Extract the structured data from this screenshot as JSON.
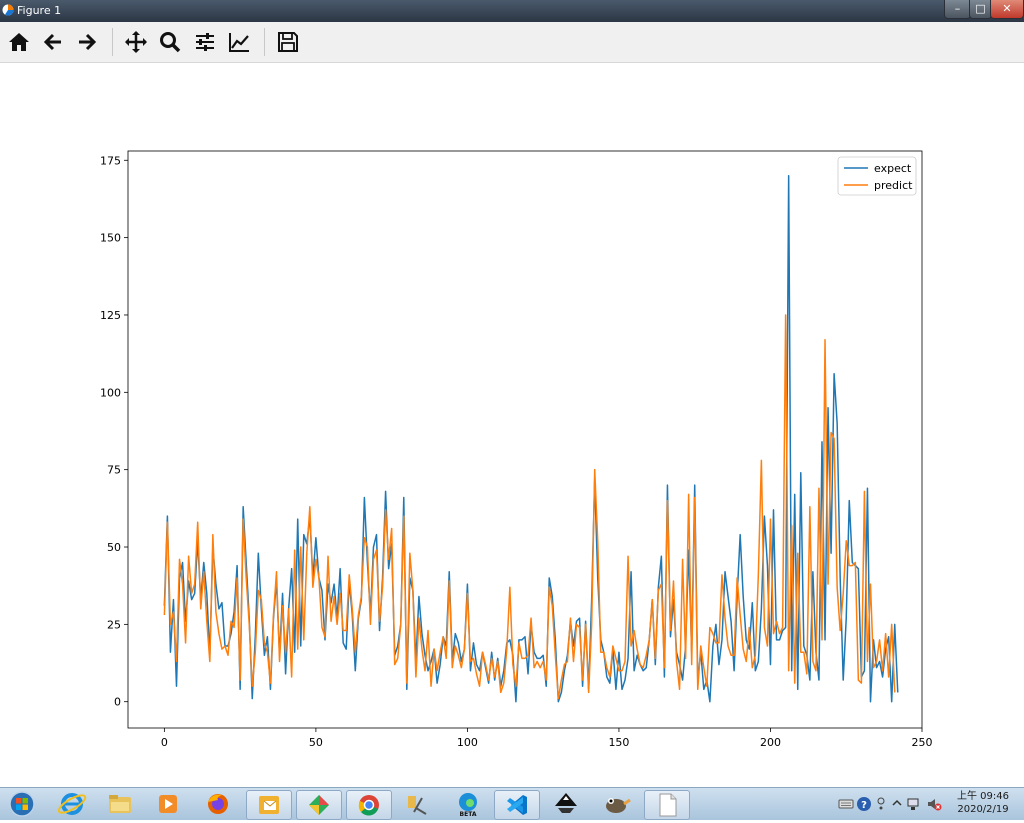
{
  "window": {
    "title": "Figure 1",
    "buttons": [
      "minimize",
      "maximize",
      "close"
    ]
  },
  "toolbar": {
    "items": [
      "home-icon",
      "back-icon",
      "forward-icon",
      "pan-icon",
      "zoom-icon",
      "configure-subplots-icon",
      "edit-axis-icon",
      "save-icon"
    ]
  },
  "chart_data": {
    "type": "line",
    "title": "",
    "xlabel": "",
    "ylabel": "",
    "xlim": [
      -12,
      250
    ],
    "ylim": [
      -8.5,
      178
    ],
    "xticks": [
      0,
      50,
      100,
      150,
      200,
      250
    ],
    "yticks": [
      0,
      25,
      50,
      75,
      100,
      125,
      150,
      175
    ],
    "legend": {
      "placement": "upper right",
      "entries": [
        "expect",
        "predict"
      ]
    },
    "colors": {
      "expect": "#1f77b4",
      "predict": "#ff7f0e"
    },
    "x_start": 0,
    "x_step": 1,
    "series": [
      {
        "name": "expect",
        "values": [
          31,
          60,
          16,
          33,
          5,
          40,
          45,
          26,
          39,
          33,
          35,
          52,
          33,
          45,
          35,
          15,
          50,
          38,
          30,
          32,
          18,
          18,
          22,
          29,
          44,
          4,
          63,
          45,
          27,
          1,
          21,
          48,
          30,
          15,
          21,
          4,
          27,
          39,
          15,
          35,
          9,
          30,
          43,
          16,
          59,
          18,
          54,
          51,
          60,
          40,
          53,
          40,
          36,
          20,
          38,
          32,
          38,
          27,
          43,
          19,
          17,
          39,
          28,
          10,
          27,
          33,
          66,
          45,
          28,
          50,
          54,
          23,
          40,
          68,
          43,
          51,
          15,
          18,
          25,
          66,
          4,
          40,
          36,
          13,
          34,
          22,
          15,
          10,
          13,
          17,
          6,
          12,
          21,
          18,
          42,
          13,
          22,
          19,
          13,
          17,
          38,
          10,
          19,
          12,
          10,
          16,
          11,
          6,
          16,
          7,
          14,
          5,
          10,
          19,
          20,
          15,
          0,
          20,
          20,
          21,
          9,
          25,
          16,
          14,
          14,
          15,
          5,
          40,
          34,
          20,
          0,
          3,
          10,
          15,
          26,
          18,
          26,
          27,
          5,
          26,
          4,
          33,
          72,
          40,
          20,
          16,
          8,
          6,
          17,
          4,
          16,
          4,
          7,
          14,
          42,
          10,
          15,
          12,
          10,
          11,
          20,
          33,
          12,
          37,
          47,
          8,
          70,
          21,
          33,
          16,
          12,
          7,
          18,
          49,
          16,
          70,
          7,
          16,
          4,
          7,
          0,
          18,
          25,
          12,
          20,
          42,
          34,
          26,
          10,
          34,
          54,
          34,
          20,
          17,
          32,
          10,
          13,
          30,
          60,
          44,
          12,
          62,
          20,
          20,
          23,
          24,
          170,
          10,
          67,
          4,
          74,
          18,
          15,
          7,
          42,
          16,
          7,
          84,
          20,
          95,
          48,
          106,
          90,
          40,
          7,
          27,
          65,
          45,
          44,
          43,
          8,
          10,
          69,
          0,
          20,
          11,
          13,
          8,
          17,
          21,
          0,
          25,
          3
        ]
      },
      {
        "name": "predict",
        "values": [
          28,
          58,
          25,
          29,
          13,
          46,
          38,
          19,
          47,
          35,
          38,
          58,
          30,
          42,
          26,
          13,
          54,
          29,
          22,
          17,
          18,
          15,
          26,
          24,
          40,
          7,
          59,
          40,
          25,
          5,
          16,
          36,
          33,
          19,
          16,
          6,
          28,
          42,
          13,
          31,
          16,
          30,
          8,
          49,
          17,
          50,
          20,
          48,
          63,
          37,
          46,
          40,
          24,
          21,
          47,
          26,
          34,
          25,
          35,
          23,
          23,
          41,
          30,
          16,
          28,
          34,
          53,
          50,
          25,
          46,
          49,
          26,
          37,
          62,
          46,
          56,
          12,
          14,
          25,
          60,
          6,
          48,
          36,
          8,
          27,
          17,
          10,
          23,
          5,
          17,
          10,
          16,
          21,
          14,
          39,
          11,
          18,
          15,
          11,
          17,
          35,
          13,
          14,
          9,
          5,
          16,
          12,
          7,
          14,
          8,
          13,
          3,
          6,
          17,
          37,
          12,
          5,
          19,
          14,
          14,
          15,
          27,
          11,
          13,
          11,
          13,
          7,
          37,
          31,
          15,
          1,
          7,
          12,
          13,
          27,
          13,
          25,
          24,
          7,
          25,
          3,
          25,
          75,
          52,
          16,
          16,
          11,
          8,
          18,
          14,
          10,
          10,
          13,
          47,
          18,
          23,
          17,
          12,
          11,
          15,
          20,
          33,
          14,
          36,
          38,
          11,
          65,
          23,
          39,
          13,
          4,
          46,
          14,
          67,
          12,
          66,
          4,
          18,
          11,
          5,
          24,
          22,
          19,
          19,
          41,
          27,
          18,
          15,
          15,
          40,
          28,
          17,
          13,
          24,
          11,
          15,
          41,
          78,
          24,
          18,
          59,
          22,
          26,
          22,
          24,
          125,
          10,
          57,
          6,
          48,
          16,
          16,
          9,
          63,
          13,
          10,
          69,
          20,
          117,
          38,
          87,
          85,
          37,
          23,
          35,
          52,
          44,
          44,
          45,
          7,
          6,
          68,
          13,
          38,
          11,
          13,
          20,
          10,
          22,
          8,
          25,
          3
        ]
      }
    ]
  },
  "taskbar": {
    "apps": [
      "start-orb",
      "ie-icon",
      "explorer-icon",
      "media-player-icon",
      "firefox-icon",
      "outlook-icon",
      "gitkraken-icon",
      "chrome-icon",
      "tool-icon",
      "edge-beta-icon",
      "vscode-icon",
      "inkscape-icon",
      "gimp-icon",
      "document-icon"
    ],
    "edge_badge": "BETA",
    "clock_time": "上午 09:46",
    "clock_date": "2020/2/19"
  }
}
